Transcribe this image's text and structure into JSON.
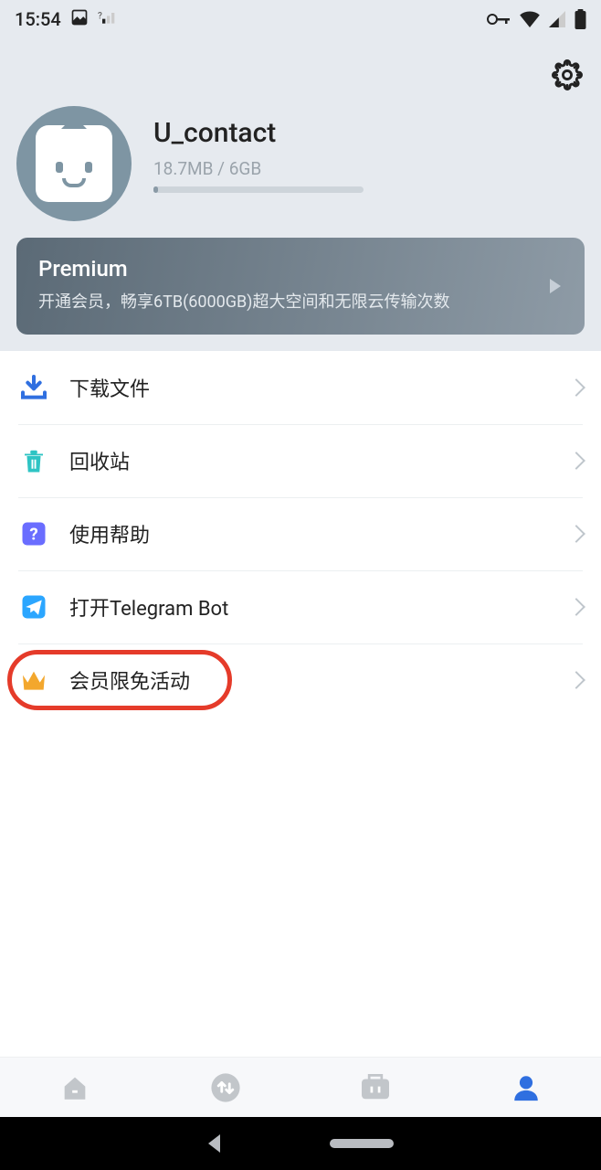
{
  "status_bar": {
    "time": "15:54"
  },
  "profile": {
    "username": "U_contact",
    "storage_used": "18.7MB",
    "storage_total": "6GB",
    "storage_text": "18.7MB / 6GB"
  },
  "premium": {
    "title": "Premium",
    "description": "开通会员，畅享6TB(6000GB)超大空间和无限云传输次数"
  },
  "menu": {
    "download": "下载文件",
    "trash": "回收站",
    "help": "使用帮助",
    "telegram": "打开Telegram Bot",
    "promo": "会员限免活动"
  },
  "colors": {
    "download": "#2f6fe0",
    "trash": "#2ec4c4",
    "help": "#6a6dff",
    "telegram": "#2ba6ff",
    "promo": "#f3a72d",
    "profile_active": "#2f6fe0"
  }
}
